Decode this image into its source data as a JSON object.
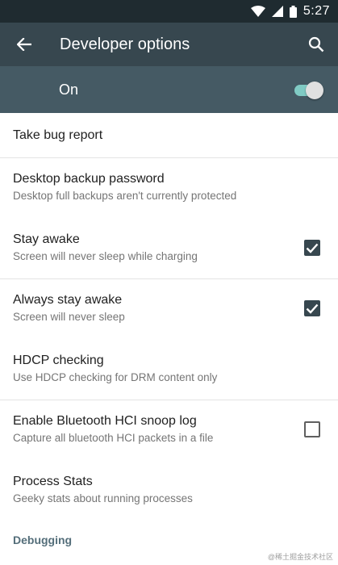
{
  "status_bar": {
    "time": "5:27",
    "icons": [
      "wifi-icon",
      "signal-icon",
      "battery-icon"
    ]
  },
  "toolbar": {
    "title": "Developer options",
    "icons": [
      "back-arrow-icon",
      "search-icon"
    ]
  },
  "master_switch": {
    "label": "On",
    "state": "on"
  },
  "items": [
    {
      "title": "Take bug report"
    },
    {
      "title": "Desktop backup password",
      "summary": "Desktop full backups aren't currently protected"
    },
    {
      "title": "Stay awake",
      "summary": "Screen will never sleep while charging",
      "checked": true
    },
    {
      "title": "Always stay awake",
      "summary": "Screen will never sleep",
      "checked": true
    },
    {
      "title": "HDCP checking",
      "summary": "Use HDCP checking for DRM content only"
    },
    {
      "title": "Enable Bluetooth HCI snoop log",
      "summary": "Capture all bluetooth HCI packets in a file",
      "checked": false
    },
    {
      "title": "Process Stats",
      "summary": "Geeky stats about running processes"
    }
  ],
  "category": "Debugging",
  "watermark": "@稀土掘金技术社区",
  "colors": {
    "status_bar": "#1f2b30",
    "toolbar": "#37474f",
    "master_switch_bar": "#455a64",
    "switch_track": "#80cbc4",
    "checkbox_checked": "#37474f",
    "category_text": "#546e7a"
  }
}
